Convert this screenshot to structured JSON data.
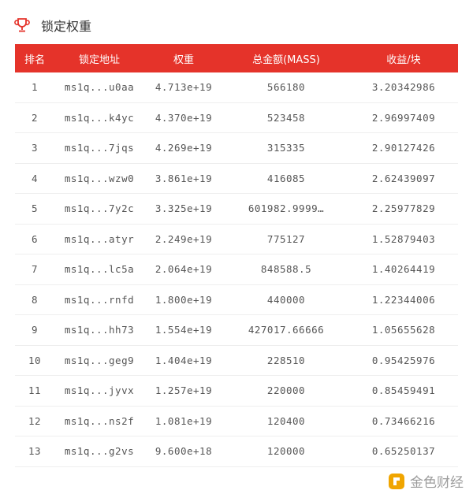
{
  "header": {
    "title": "锁定权重",
    "icon": "trophy-icon"
  },
  "table": {
    "columns": [
      "排名",
      "锁定地址",
      "权重",
      "总金额(MASS)",
      "收益/块"
    ],
    "rows": [
      [
        "1",
        "ms1q...u0aa",
        "4.713e+19",
        "566180",
        "3.20342986"
      ],
      [
        "2",
        "ms1q...k4yc",
        "4.370e+19",
        "523458",
        "2.96997409"
      ],
      [
        "3",
        "ms1q...7jqs",
        "4.269e+19",
        "315335",
        "2.90127426"
      ],
      [
        "4",
        "ms1q...wzw0",
        "3.861e+19",
        "416085",
        "2.62439097"
      ],
      [
        "5",
        "ms1q...7y2c",
        "3.325e+19",
        "601982.9999…",
        "2.25977829"
      ],
      [
        "6",
        "ms1q...atyr",
        "2.249e+19",
        "775127",
        "1.52879403"
      ],
      [
        "7",
        "ms1q...lc5a",
        "2.064e+19",
        "848588.5",
        "1.40264419"
      ],
      [
        "8",
        "ms1q...rnfd",
        "1.800e+19",
        "440000",
        "1.22344006"
      ],
      [
        "9",
        "ms1q...hh73",
        "1.554e+19",
        "427017.66666",
        "1.05655628"
      ],
      [
        "10",
        "ms1q...geg9",
        "1.404e+19",
        "228510",
        "0.95425976"
      ],
      [
        "11",
        "ms1q...jyvx",
        "1.257e+19",
        "220000",
        "0.85459491"
      ],
      [
        "12",
        "ms1q...ns2f",
        "1.081e+19",
        "120400",
        "0.73466216"
      ],
      [
        "13",
        "ms1q...g2vs",
        "9.600e+18",
        "120000",
        "0.65250137"
      ]
    ]
  },
  "watermark": {
    "text": "金色财经",
    "icon": "jinse-logo-icon"
  },
  "colors": {
    "header_bg": "#e5332a",
    "accent": "#e5332a"
  }
}
